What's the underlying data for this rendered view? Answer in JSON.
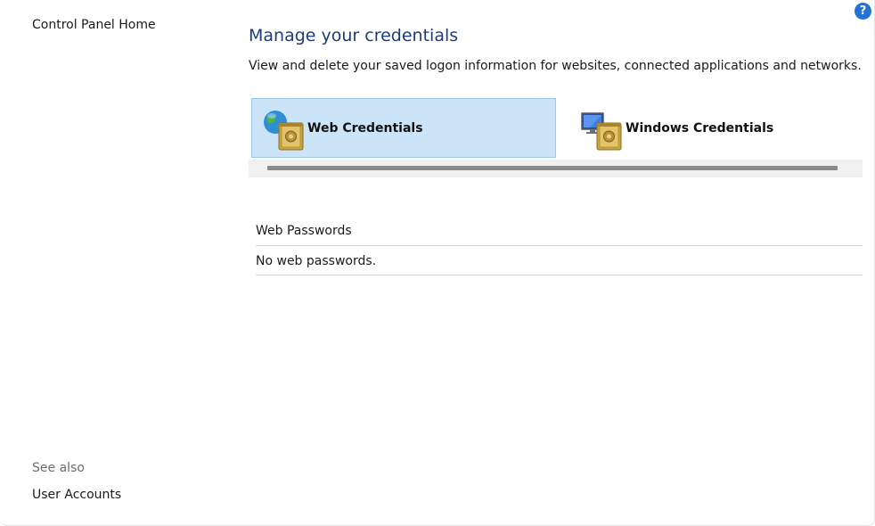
{
  "sidebar": {
    "home_link": "Control Panel Home",
    "see_also_label": "See also",
    "see_also_links": [
      "User Accounts"
    ]
  },
  "help_button": {
    "label": "?",
    "icon": "help-icon",
    "color": "#1f74d4"
  },
  "main": {
    "title": "Manage your credentials",
    "description": "View and delete your saved logon information for websites, connected applications and networks.",
    "tiles": [
      {
        "label": "Web Credentials",
        "icon": "web-credentials-icon",
        "selected": true
      },
      {
        "label": "Windows Credentials",
        "icon": "windows-credentials-icon",
        "selected": false
      }
    ],
    "section": {
      "header": "Web Passwords",
      "empty_message": "No web passwords."
    }
  },
  "colors": {
    "title": "#1e3c78",
    "selected_tile_bg": "#cce4f7",
    "selected_tile_border": "#99c9ef"
  }
}
